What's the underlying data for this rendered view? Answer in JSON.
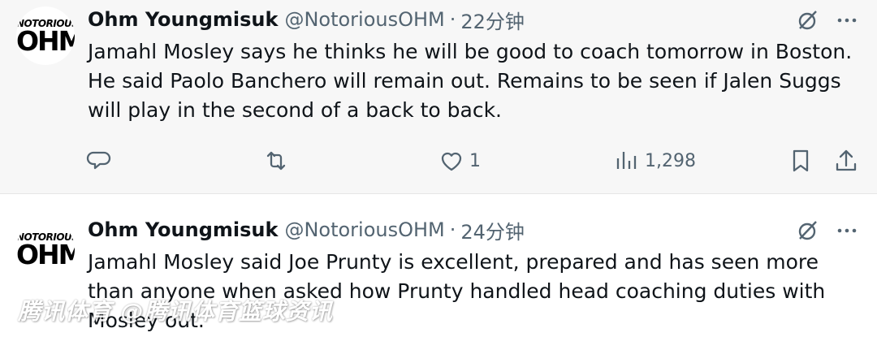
{
  "tweets": [
    {
      "avatar": {
        "line1": "NOTORIOUS",
        "line2": "OHM"
      },
      "name": "Ohm Youngmisuk",
      "handle": "@NotoriousOHM",
      "separator": "·",
      "time": "22分钟",
      "text_lines": [
        "Jamahl Mosley says he thinks he will be good to coach tomorrow in Boston.",
        "He said Paolo Banchero will remain out. Remains to be seen if Jalen Suggs",
        "will play in the second of a back to back."
      ],
      "actions": {
        "reply_icon": "reply-icon",
        "retweet_icon": "retweet-icon",
        "like_icon": "heart-icon",
        "like_count": "1",
        "views_icon": "views-icon",
        "views_count": "1,298",
        "bookmark_icon": "bookmark-icon",
        "share_icon": "share-icon"
      }
    },
    {
      "avatar": {
        "line1": "NOTORIOUS",
        "line2": "OHM"
      },
      "name": "Ohm Youngmisuk",
      "handle": "@NotoriousOHM",
      "separator": "·",
      "time": "24分钟",
      "text_lines": [
        "Jamahl Mosley said Joe Prunty is excellent, prepared and has seen more",
        "than anyone when asked how Prunty handled head coaching duties with",
        "Mosley out."
      ]
    }
  ],
  "watermark": "腾讯体育 @腾讯体育篮球资讯",
  "colors": {
    "text": "#0f1419",
    "muted": "#536471",
    "bg_first": "#f7f7f7"
  }
}
